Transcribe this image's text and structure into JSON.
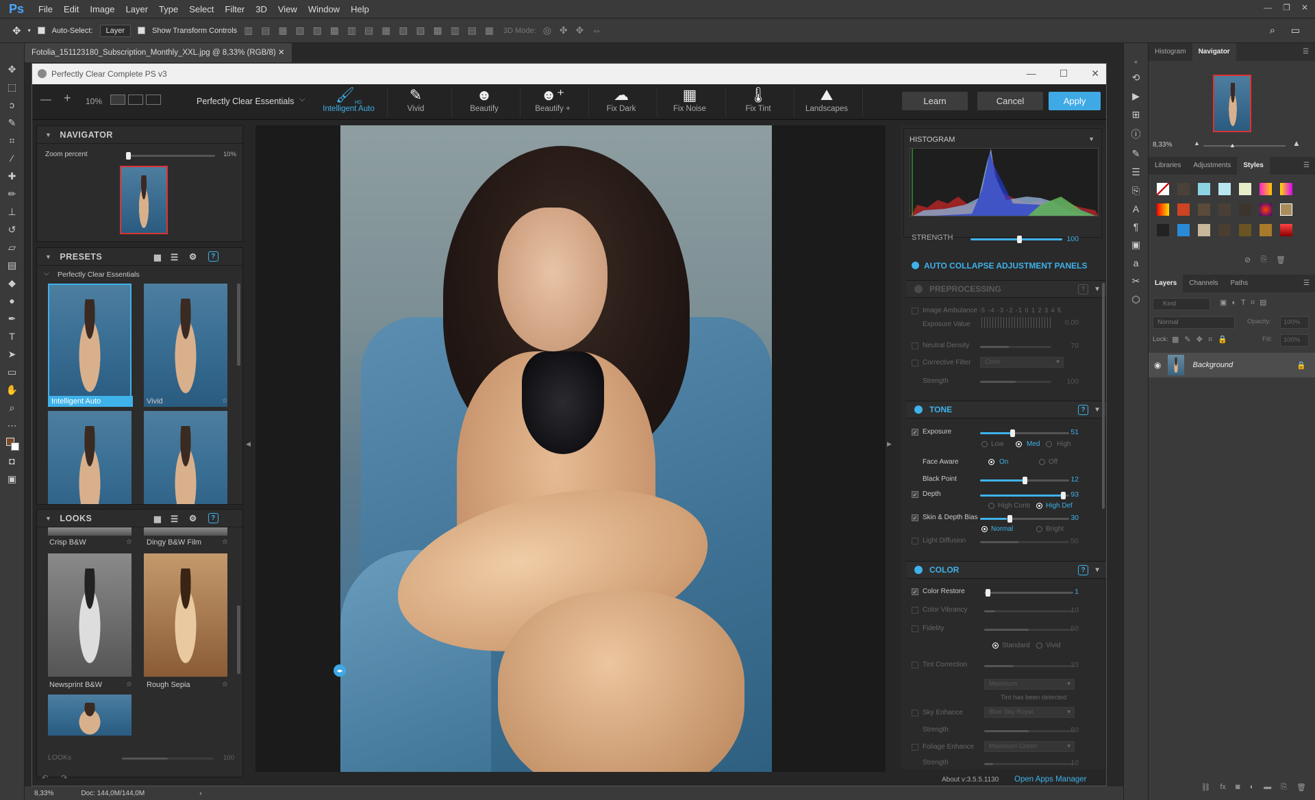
{
  "ps": {
    "logo": "Ps",
    "menu": [
      "File",
      "Edit",
      "Image",
      "Layer",
      "Type",
      "Select",
      "Filter",
      "3D",
      "View",
      "Window",
      "Help"
    ],
    "options": {
      "auto_select": "Auto-Select:",
      "auto_select_value": "Layer",
      "transform_controls": "Show Transform Controls",
      "mode_3d": "3D Mode:"
    },
    "doc_tab": "Fotolia_151123180_Subscription_Monthly_XXL.jpg @ 8,33% (RGB/8)",
    "status_zoom": "8,33%",
    "status_doc": "Doc: 144,0M/144,0M",
    "panels": {
      "top_tabs": [
        "Histogram",
        "Navigator"
      ],
      "nav_zoom": "8,33%",
      "mid_tabs": [
        "Libraries",
        "Adjustments",
        "Styles"
      ],
      "layer_tabs": [
        "Layers",
        "Channels",
        "Paths"
      ],
      "kind": "Kind",
      "blend": "Normal",
      "opacity_label": "Opacity:",
      "opacity": "100%",
      "lock_label": "Lock:",
      "fill_label": "Fill:",
      "fill": "100%",
      "layer_name": "Background"
    }
  },
  "plugin": {
    "title": "Perfectly Clear Complete PS v3",
    "zoom": "10%",
    "preset_name": "Perfectly Clear Essentials",
    "tools": [
      {
        "label": "Intelligent Auto",
        "icon": "brush-hd-icon",
        "badge": "HD"
      },
      {
        "label": "Vivid",
        "icon": "brush-icon"
      },
      {
        "label": "Beautify",
        "icon": "face-icon"
      },
      {
        "label": "Beautify +",
        "icon": "face-plus-icon"
      },
      {
        "label": "Fix Dark",
        "icon": "cloud-icon"
      },
      {
        "label": "Fix Noise",
        "icon": "noise-icon"
      },
      {
        "label": "Fix Tint",
        "icon": "thermometer-icon"
      },
      {
        "label": "Landscapes",
        "icon": "landscape-icon"
      }
    ],
    "learn": "Learn",
    "cancel": "Cancel",
    "apply": "Apply",
    "about": "About v:3.5.5.1130",
    "open_apps": "Open Apps Manager",
    "navigator": {
      "title": "NAVIGATOR",
      "zoom_label": "Zoom percent",
      "zoom_value": "10%"
    },
    "presets": {
      "title": "PRESETS",
      "group": "Perfectly Clear Essentials",
      "items": [
        "Intelligent Auto",
        "Vivid",
        "",
        ""
      ]
    },
    "looks": {
      "title": "LOOKS",
      "items": [
        "Crisp B&W",
        "Dingy B&W Film",
        "Newsprint B&W",
        "Rough Sepia"
      ],
      "strength_label": "LOOKs",
      "strength_value": "100"
    },
    "right": {
      "histogram": "HISTOGRAM",
      "strength_label": "STRENGTH",
      "strength_value": "100",
      "auto_collapse": "AUTO COLLAPSE ADJUSTMENT PANELS",
      "preprocessing": {
        "title": "PREPROCESSING",
        "image_ambulance": "Image Ambulance",
        "scale": "-5 -4 -3 -2 -1 0 1 2 3 4 5",
        "exposure_value_label": "Exposure Value",
        "exposure_value": "0,00",
        "neutral_density": "Neutral Density",
        "neutral_density_value": "70",
        "corrective_filter": "Corrective Filter",
        "corrective_filter_value": "Color",
        "strength": "Strength",
        "strength_value": "100"
      },
      "tone": {
        "title": "TONE",
        "exposure": "Exposure",
        "exposure_value": "51",
        "exposure_opts": [
          "Low",
          "Med",
          "High"
        ],
        "face_aware": "Face Aware",
        "face_opts": [
          "On",
          "Off"
        ],
        "black_point": "Black Point",
        "black_point_value": "12",
        "depth": "Depth",
        "depth_value": "93",
        "depth_opts": [
          "High Contr",
          "High Def"
        ],
        "skin_depth": "Skin & Depth Bias",
        "skin_depth_value": "30",
        "skin_opts": [
          "Normal",
          "Bright"
        ],
        "light_diffusion": "Light Diffusion",
        "light_diffusion_value": "50"
      },
      "color": {
        "title": "COLOR",
        "color_restore": "Color Restore",
        "color_restore_value": "1",
        "color_vibrancy": "Color Vibrancy",
        "color_vibrancy_value": "10",
        "fidelity": "Fidelity",
        "fidelity_value": "50",
        "fidelity_opts": [
          "Standard",
          "Vivid"
        ],
        "tint_correction": "Tint Correction",
        "tint_correction_value": "33",
        "tint_mode": "Maximum",
        "tint_note": "Tint has been detected",
        "sky_enhance": "Sky Enhance",
        "sky_mode": "Blue Sky Royal",
        "sky_strength": "Strength",
        "sky_strength_value": "50",
        "foliage_enhance": "Foliage Enhance",
        "foliage_mode": "Maximum Green",
        "foliage_strength": "Strength",
        "foliage_strength_value": "10"
      }
    }
  }
}
